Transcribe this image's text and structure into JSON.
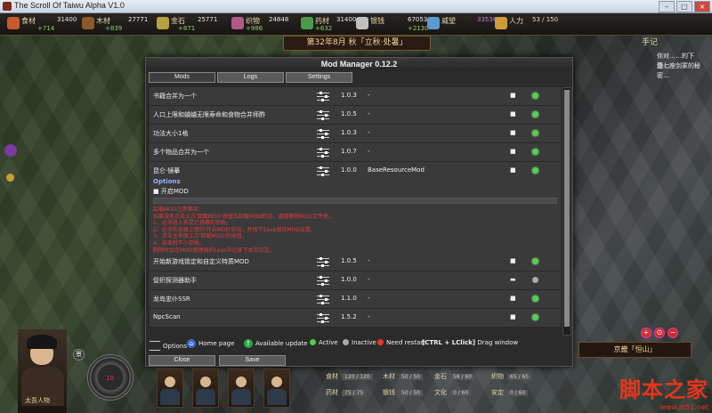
{
  "window": {
    "title": "The Scroll Of Taiwu Alpha V1.0",
    "buttons": [
      "–",
      "□",
      "×"
    ]
  },
  "resources": [
    {
      "name": "食材",
      "value": "31400",
      "delta": "+714",
      "color": "#c75a2c"
    },
    {
      "name": "木材",
      "value": "27771",
      "delta": "+839",
      "color": "#8b5a2b"
    },
    {
      "name": "金石",
      "value": "25771",
      "delta": "+871",
      "color": "#b8a040"
    },
    {
      "name": "织物",
      "value": "24848",
      "delta": "+986",
      "color": "#b05a8a"
    },
    {
      "name": "药材",
      "value": "31400",
      "delta": "+632",
      "color": "#4a9a4a"
    },
    {
      "name": "银钱",
      "value": "67053",
      "delta": "+2130",
      "color": "#c0c0c0"
    },
    {
      "name": "威望",
      "value": "33536",
      "delta": "",
      "color": "#5a9ad0"
    },
    {
      "name": "人力",
      "value": "53 / 150",
      "delta": "",
      "color": "#d09a3a"
    }
  ],
  "season": "第32年8月 秋「立秋·处暑」",
  "notes": {
    "title": "手记",
    "lines": [
      "你对……的下落…",
      "边七座剑冢的秘密…"
    ]
  },
  "modal": {
    "title": "Mod Manager 0.12.2",
    "tabs": [
      "Mods",
      "Logs",
      "Settings"
    ],
    "mods_top": [
      {
        "name": "书籍合并为一个",
        "version": "1.0.3",
        "dep": "-",
        "enabled": true
      },
      {
        "name": "人口上限和蛐蛐无限寿命和食物合并师酢",
        "version": "1.0.5",
        "dep": "-",
        "enabled": true
      },
      {
        "name": "功法大小1格",
        "version": "1.0.3",
        "dep": "-",
        "enabled": true
      },
      {
        "name": "多个物品合并为一个",
        "version": "1.0.7",
        "dep": "-",
        "enabled": true
      },
      {
        "name": "昆仑·镜摹",
        "version": "1.0.0",
        "dep": "BaseResourceMod",
        "enabled": true
      }
    ],
    "options_title": "Options",
    "option_item": "■ 开启MOD",
    "notice": [
      "卸载MOD注意事项：",
      "如果没有点击上方'卸载MOD'按钮去卸载MOD的话，直接删除MOD文件夹...",
      "1、必须进入有昆仑镜摹的存档。",
      "2、必须先去掉上面的'开启MOD'的勾，并按下Save保存MOD设置。",
      "3、点击主界面上方'卸载MOD'的按钮。",
      "4、结束时不小存档。",
      "删除时会在MOD管理器的Logs中记录下本次日志。"
    ],
    "mods_bottom": [
      {
        "name": "开始新游戏锁定和自定义特质MOD",
        "version": "1.0.5",
        "dep": "-",
        "enabled": true
      },
      {
        "name": "促织探测器助手",
        "version": "1.0.0",
        "dep": "-",
        "enabled": false
      },
      {
        "name": "龙岛忠仆SSR",
        "version": "1.1.0",
        "dep": "-",
        "enabled": true
      },
      {
        "name": "NpcScan",
        "version": "1.5.2",
        "dep": "-",
        "enabled": true
      }
    ],
    "legend": {
      "options": "Options",
      "home": "Home page",
      "update": "Available update",
      "active": "Active",
      "inactive": "Inactive",
      "restart": "Need restart",
      "drag_key": "[CTRL + LClick]",
      "drag": "Drag window"
    },
    "buttons": {
      "close": "Close",
      "save": "Save"
    }
  },
  "hud": {
    "char_name": "太吾人物",
    "hp_badge": "景",
    "hp": "10",
    "location": "京畿「恒山」",
    "stats": [
      {
        "name": "食材",
        "value": "120 / 120"
      },
      {
        "name": "木材",
        "value": "50 / 50"
      },
      {
        "name": "金石",
        "value": "56 / 60"
      },
      {
        "name": "织物",
        "value": "65 / 65"
      },
      {
        "name": "药材",
        "value": "75 / 75"
      },
      {
        "name": "银钱",
        "value": "50 / 50"
      },
      {
        "name": "文化",
        "value": "0 / 60"
      },
      {
        "name": "安定",
        "value": "0 / 60"
      }
    ]
  },
  "watermark": {
    "main": "脚本之家",
    "url": "www.jb51.net"
  }
}
